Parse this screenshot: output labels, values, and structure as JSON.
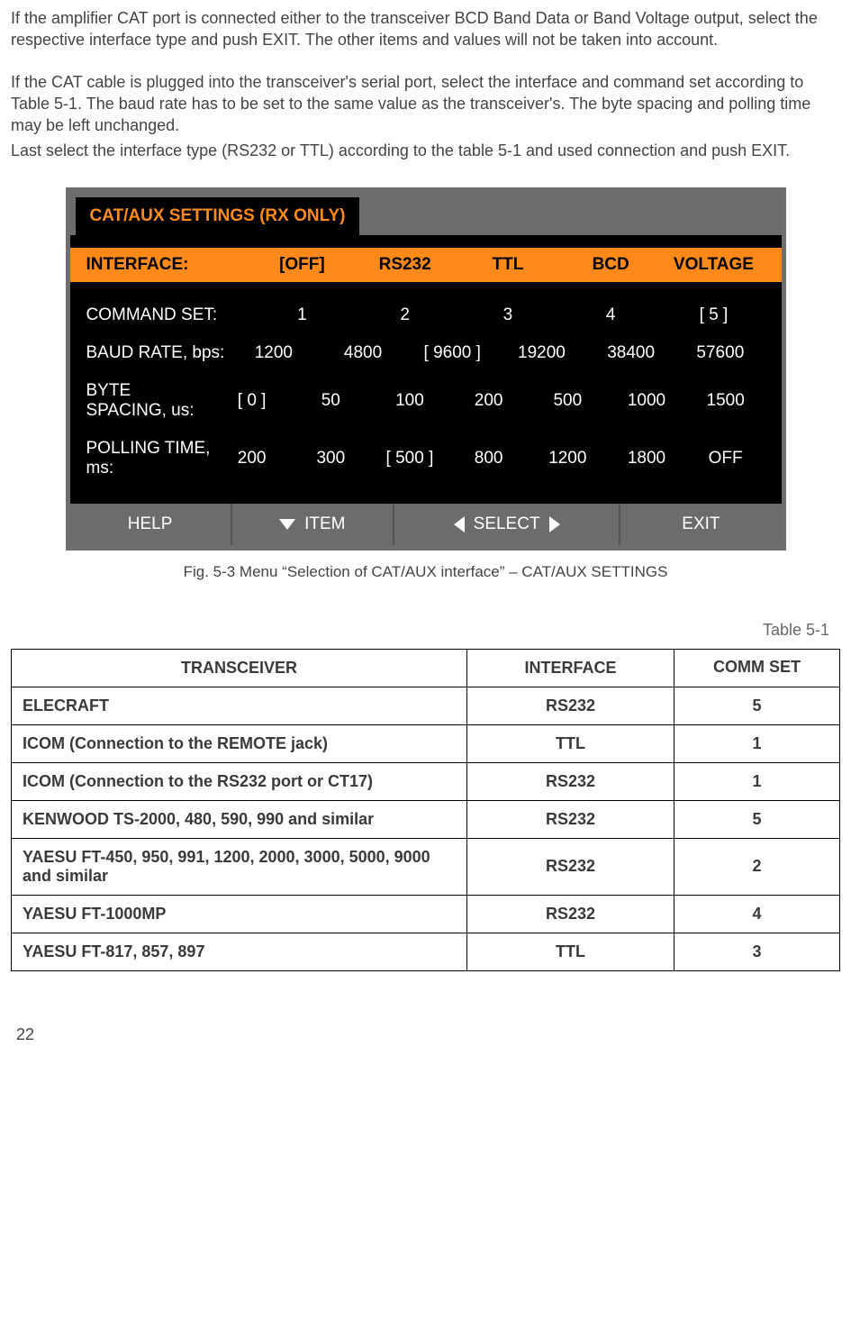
{
  "paragraph1_a": "If the amplifier CAT port is connected either to the transceiver BCD Band Data or Band Voltage output, select the respective interface type and push EXIT. The other items and values will not be taken into account.",
  "paragraph2_a": "If the CAT cable is plugged into the transceiver's serial port, select the interface and command set according to Table 5-1. The baud rate has to be set to the same value as the transceiver's. The byte spacing and polling time may be left unchanged.",
  "paragraph2_b": "Last select the interface type (RS232 or TTL) according to the table 5-1 and used connection and push EXIT.",
  "screen": {
    "title": "CAT/AUX SETTINGS (RX ONLY)",
    "rows": {
      "interface": {
        "label": "INTERFACE:",
        "opts": [
          "[OFF]",
          "RS232",
          "TTL",
          "BCD",
          "VOLTAGE"
        ]
      },
      "commandset": {
        "label": "COMMAND SET:",
        "opts": [
          "1",
          "2",
          "3",
          "4",
          "[ 5 ]"
        ]
      },
      "baud": {
        "label": "BAUD RATE, bps:",
        "opts": [
          "1200",
          "4800",
          "[ 9600 ]",
          "19200",
          "38400",
          "57600"
        ]
      },
      "bytespacing": {
        "label": "BYTE SPACING, us:",
        "opts": [
          "[ 0 ]",
          "50",
          "100",
          "200",
          "500",
          "1000",
          "1500"
        ]
      },
      "polling": {
        "label": "POLLING TIME, ms:",
        "opts": [
          "200",
          "300",
          "[ 500 ]",
          "800",
          "1200",
          "1800",
          "OFF"
        ]
      }
    },
    "buttons": {
      "help": "HELP",
      "item": "ITEM",
      "select": "SELECT",
      "exit": "EXIT"
    }
  },
  "figcaption": "Fig. 5-3 Menu “Selection of CAT/AUX interface” – CAT/AUX SETTINGS",
  "tablelabel": "Table 5-1",
  "table": {
    "headers": {
      "transceiver": "TRANSCEIVER",
      "interface": "INTERFACE",
      "commset": "COMM SET"
    },
    "rows": [
      {
        "t": "ELECRAFT",
        "i": "RS232",
        "c": "5"
      },
      {
        "t": "ICOM (Connection to the REMOTE jack)",
        "i": "TTL",
        "c": "1"
      },
      {
        "t": "ICOM (Connection to the RS232 port or CT17)",
        "i": "RS232",
        "c": "1"
      },
      {
        "t": "KENWOOD TS-2000, 480, 590, 990 and similar",
        "i": "RS232",
        "c": "5"
      },
      {
        "t": "YAESU FT-450, 950, 991, 1200, 2000, 3000, 5000, 9000 and similar",
        "i": "RS232",
        "c": "2"
      },
      {
        "t": "YAESU FT-1000MP",
        "i": "RS232",
        "c": "4"
      },
      {
        "t": "YAESU FT-817, 857, 897",
        "i": "TTL",
        "c": "3"
      }
    ]
  },
  "pagenum": "22"
}
